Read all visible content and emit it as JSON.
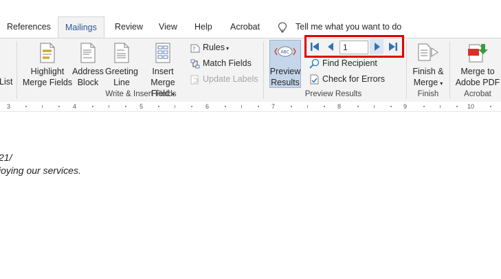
{
  "tabs": [
    {
      "label": "References"
    },
    {
      "label": "Mailings"
    },
    {
      "label": "Review"
    },
    {
      "label": "View"
    },
    {
      "label": "Help"
    },
    {
      "label": "Acrobat"
    }
  ],
  "tell_me": "Tell me what you want to do",
  "ribbon": {
    "list_fragment": "List",
    "highlight": {
      "line1": "Highlight",
      "line2": "Merge Fields"
    },
    "address": {
      "line1": "Address",
      "line2": "Block"
    },
    "greeting": {
      "line1": "Greeting",
      "line2": "Line"
    },
    "insert_merge": {
      "line1": "Insert Merge",
      "line2": "Field"
    },
    "rules": "Rules",
    "match_fields": "Match Fields",
    "update_labels": "Update Labels",
    "write_insert_group": "Write & Insert Fields",
    "preview": {
      "line1": "Preview",
      "line2": "Results"
    },
    "record_number": "1",
    "find_recipient": "Find Recipient",
    "check_errors": "Check for Errors",
    "preview_group": "Preview Results",
    "finish": {
      "line1": "Finish &",
      "line2": "Merge"
    },
    "finish_group": "Finish",
    "merge_pdf": {
      "line1": "Merge to",
      "line2": "Adobe PDF"
    },
    "acrobat_group": "Acrobat",
    "abc_glyph": "ABC"
  },
  "ruler": [
    "3",
    "4",
    "5",
    "6",
    "7",
    "8",
    "9",
    "10"
  ],
  "document": {
    "line1": "21/",
    "line2": "joying our services."
  },
  "colors": {
    "accent": "#2b579a",
    "highlight_box": "#e00000",
    "nav_blue": "#2e75b6",
    "ribbon_bg": "#f3f3f3"
  }
}
